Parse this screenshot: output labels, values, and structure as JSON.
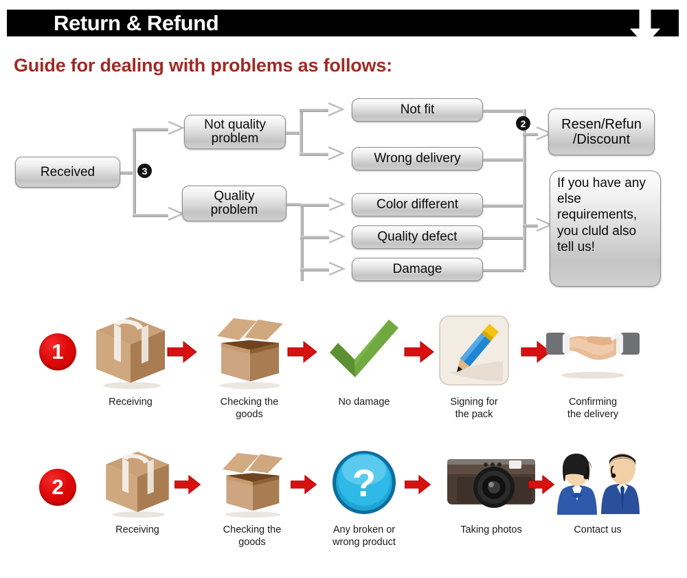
{
  "header": {
    "title": "Return & Refund",
    "arrow_icon": "down-arrow-icon",
    "bar_color": "#000000",
    "title_color": "#ffffff"
  },
  "subtitle": {
    "text": "Guide for dealing with problems as follows:",
    "color": "#9e2b25"
  },
  "flowchart": {
    "nodes": {
      "received": "Received",
      "not_quality_problem": "Not quality\nproblem",
      "quality_problem": "Quality\nproblem",
      "not_fit": "Not fit",
      "wrong_delivery": "Wrong delivery",
      "color_different": "Color different",
      "quality_defect": "Quality defect",
      "damage": "Damage",
      "resolution": "Resen/Refun\n/Discount",
      "note": "If you have any else requirements, you cluld also tell us!"
    },
    "badges": {
      "branch_badge": "3",
      "resolution_badge": "2"
    }
  },
  "steps": {
    "row1": {
      "number": "1",
      "items": [
        {
          "icon": "sealed-box-icon",
          "label": "Receiving"
        },
        {
          "icon": "open-box-icon",
          "label": "Checking the\ngoods"
        },
        {
          "icon": "green-check-icon",
          "label": "No damage"
        },
        {
          "icon": "pencil-signing-icon",
          "label": "Signing for\nthe pack"
        },
        {
          "icon": "handshake-icon",
          "label": "Confirming\nthe delivery"
        }
      ]
    },
    "row2": {
      "number": "2",
      "items": [
        {
          "icon": "sealed-box-icon",
          "label": "Receiving"
        },
        {
          "icon": "open-box-icon",
          "label": "Checking the\ngoods"
        },
        {
          "icon": "question-mark-icon",
          "label": "Any broken or\nwrong product"
        },
        {
          "icon": "camera-icon",
          "label": "Taking photos"
        },
        {
          "icon": "support-agents-icon",
          "label": "Contact us"
        }
      ]
    },
    "arrow_icon": "right-arrow-icon",
    "arrow_color": "#d81010"
  }
}
